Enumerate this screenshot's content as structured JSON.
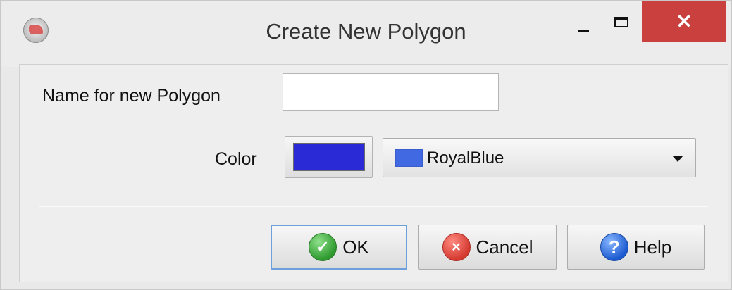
{
  "window": {
    "title": "Create New Polygon",
    "minimize_icon": "minimize-icon",
    "maximize_icon": "maximize-icon",
    "close_icon": "close-icon",
    "close_glyph": "✕"
  },
  "form": {
    "name_label": "Name for new Polygon",
    "name_value": "",
    "color_label": "Color",
    "color_swatch_hex": "#2a2ad6",
    "color_select": {
      "selected": "RoyalBlue",
      "selected_hex": "#4169e1"
    }
  },
  "buttons": {
    "ok": {
      "label": "OK",
      "icon": "check-icon"
    },
    "cancel": {
      "label": "Cancel",
      "icon": "cancel-icon"
    },
    "help": {
      "label": "Help",
      "icon": "help-icon"
    }
  },
  "colors": {
    "close_button": "#c9403f",
    "focus_border": "#6ea1dc"
  }
}
